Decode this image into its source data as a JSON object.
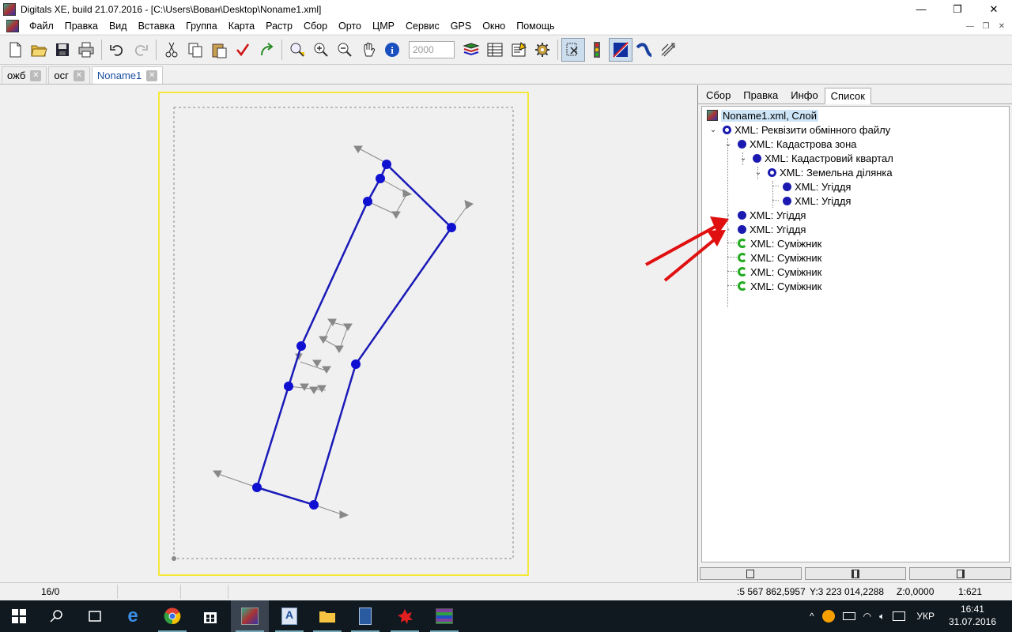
{
  "window": {
    "title": "Digitals XE, build 21.07.2016 - [C:\\Users\\Вован\\Desktop\\Noname1.xml]",
    "minimize": "—",
    "restore": "❐",
    "close": "✕"
  },
  "menu": {
    "items": [
      "Файл",
      "Правка",
      "Вид",
      "Вставка",
      "Группа",
      "Карта",
      "Растр",
      "Сбор",
      "Орто",
      "ЦМР",
      "Сервис",
      "GPS",
      "Окно",
      "Помощь"
    ],
    "mdi_min": "—",
    "mdi_restore": "❐",
    "mdi_close": "✕"
  },
  "toolbar": {
    "scale_value": "2000",
    "icons": [
      "new-icon",
      "open-icon",
      "save-icon",
      "print-icon",
      "undo-icon",
      "redo-icon",
      "cut-icon",
      "copy-icon",
      "paste-icon",
      "check-icon",
      "forward-icon",
      "zoom-to-icon",
      "zoom-in-icon",
      "zoom-out-icon",
      "pan-hand-icon",
      "info-icon",
      "layers-icon",
      "table-icon",
      "form-icon",
      "settings-icon",
      "select-tool-icon",
      "traffic-light-icon",
      "draw-tool-icon",
      "curve-tool-icon",
      "vector-tool-icon"
    ]
  },
  "doc_tabs": [
    {
      "label": "ожб",
      "active": false
    },
    {
      "label": "осг",
      "active": false
    },
    {
      "label": "Noname1",
      "active": true
    }
  ],
  "panel": {
    "tabs": [
      {
        "label": "Сбор",
        "active": false
      },
      {
        "label": "Правка",
        "active": false
      },
      {
        "label": "Инфо",
        "active": false
      },
      {
        "label": "Список",
        "active": true
      }
    ],
    "tree": {
      "root": "Noname1.xml, Слой",
      "n1": "XML: Реквізити обмінного файлу",
      "n2": "XML: Кадастрова зона",
      "n3": "XML: Кадастровий квартал",
      "n4": "XML: Земельна ділянка",
      "n5": "XML: Угіддя",
      "n6": "XML: Угіддя",
      "n7": "XML: Угіддя",
      "n8": "XML: Угіддя",
      "n9": "XML: Суміжник",
      "n10": "XML: Суміжник",
      "n11": "XML: Суміжник",
      "n12": "XML: Суміжник"
    }
  },
  "status": {
    "objects": "16/0",
    "coords": ":5 567 862,5957",
    "coords_y": "Y:3 223 014,2288",
    "z": "Z:0,0000",
    "scale": "1:621"
  },
  "taskbar": {
    "language": "УКР",
    "time": "16:41",
    "date": "31.07.2016"
  },
  "colors": {
    "parcel_line": "#1a1ab8",
    "vertex": "#1010d0",
    "sheet_border": "#f5e600",
    "annotation_arrow": "#e01010",
    "symbol_gray": "#888888"
  }
}
